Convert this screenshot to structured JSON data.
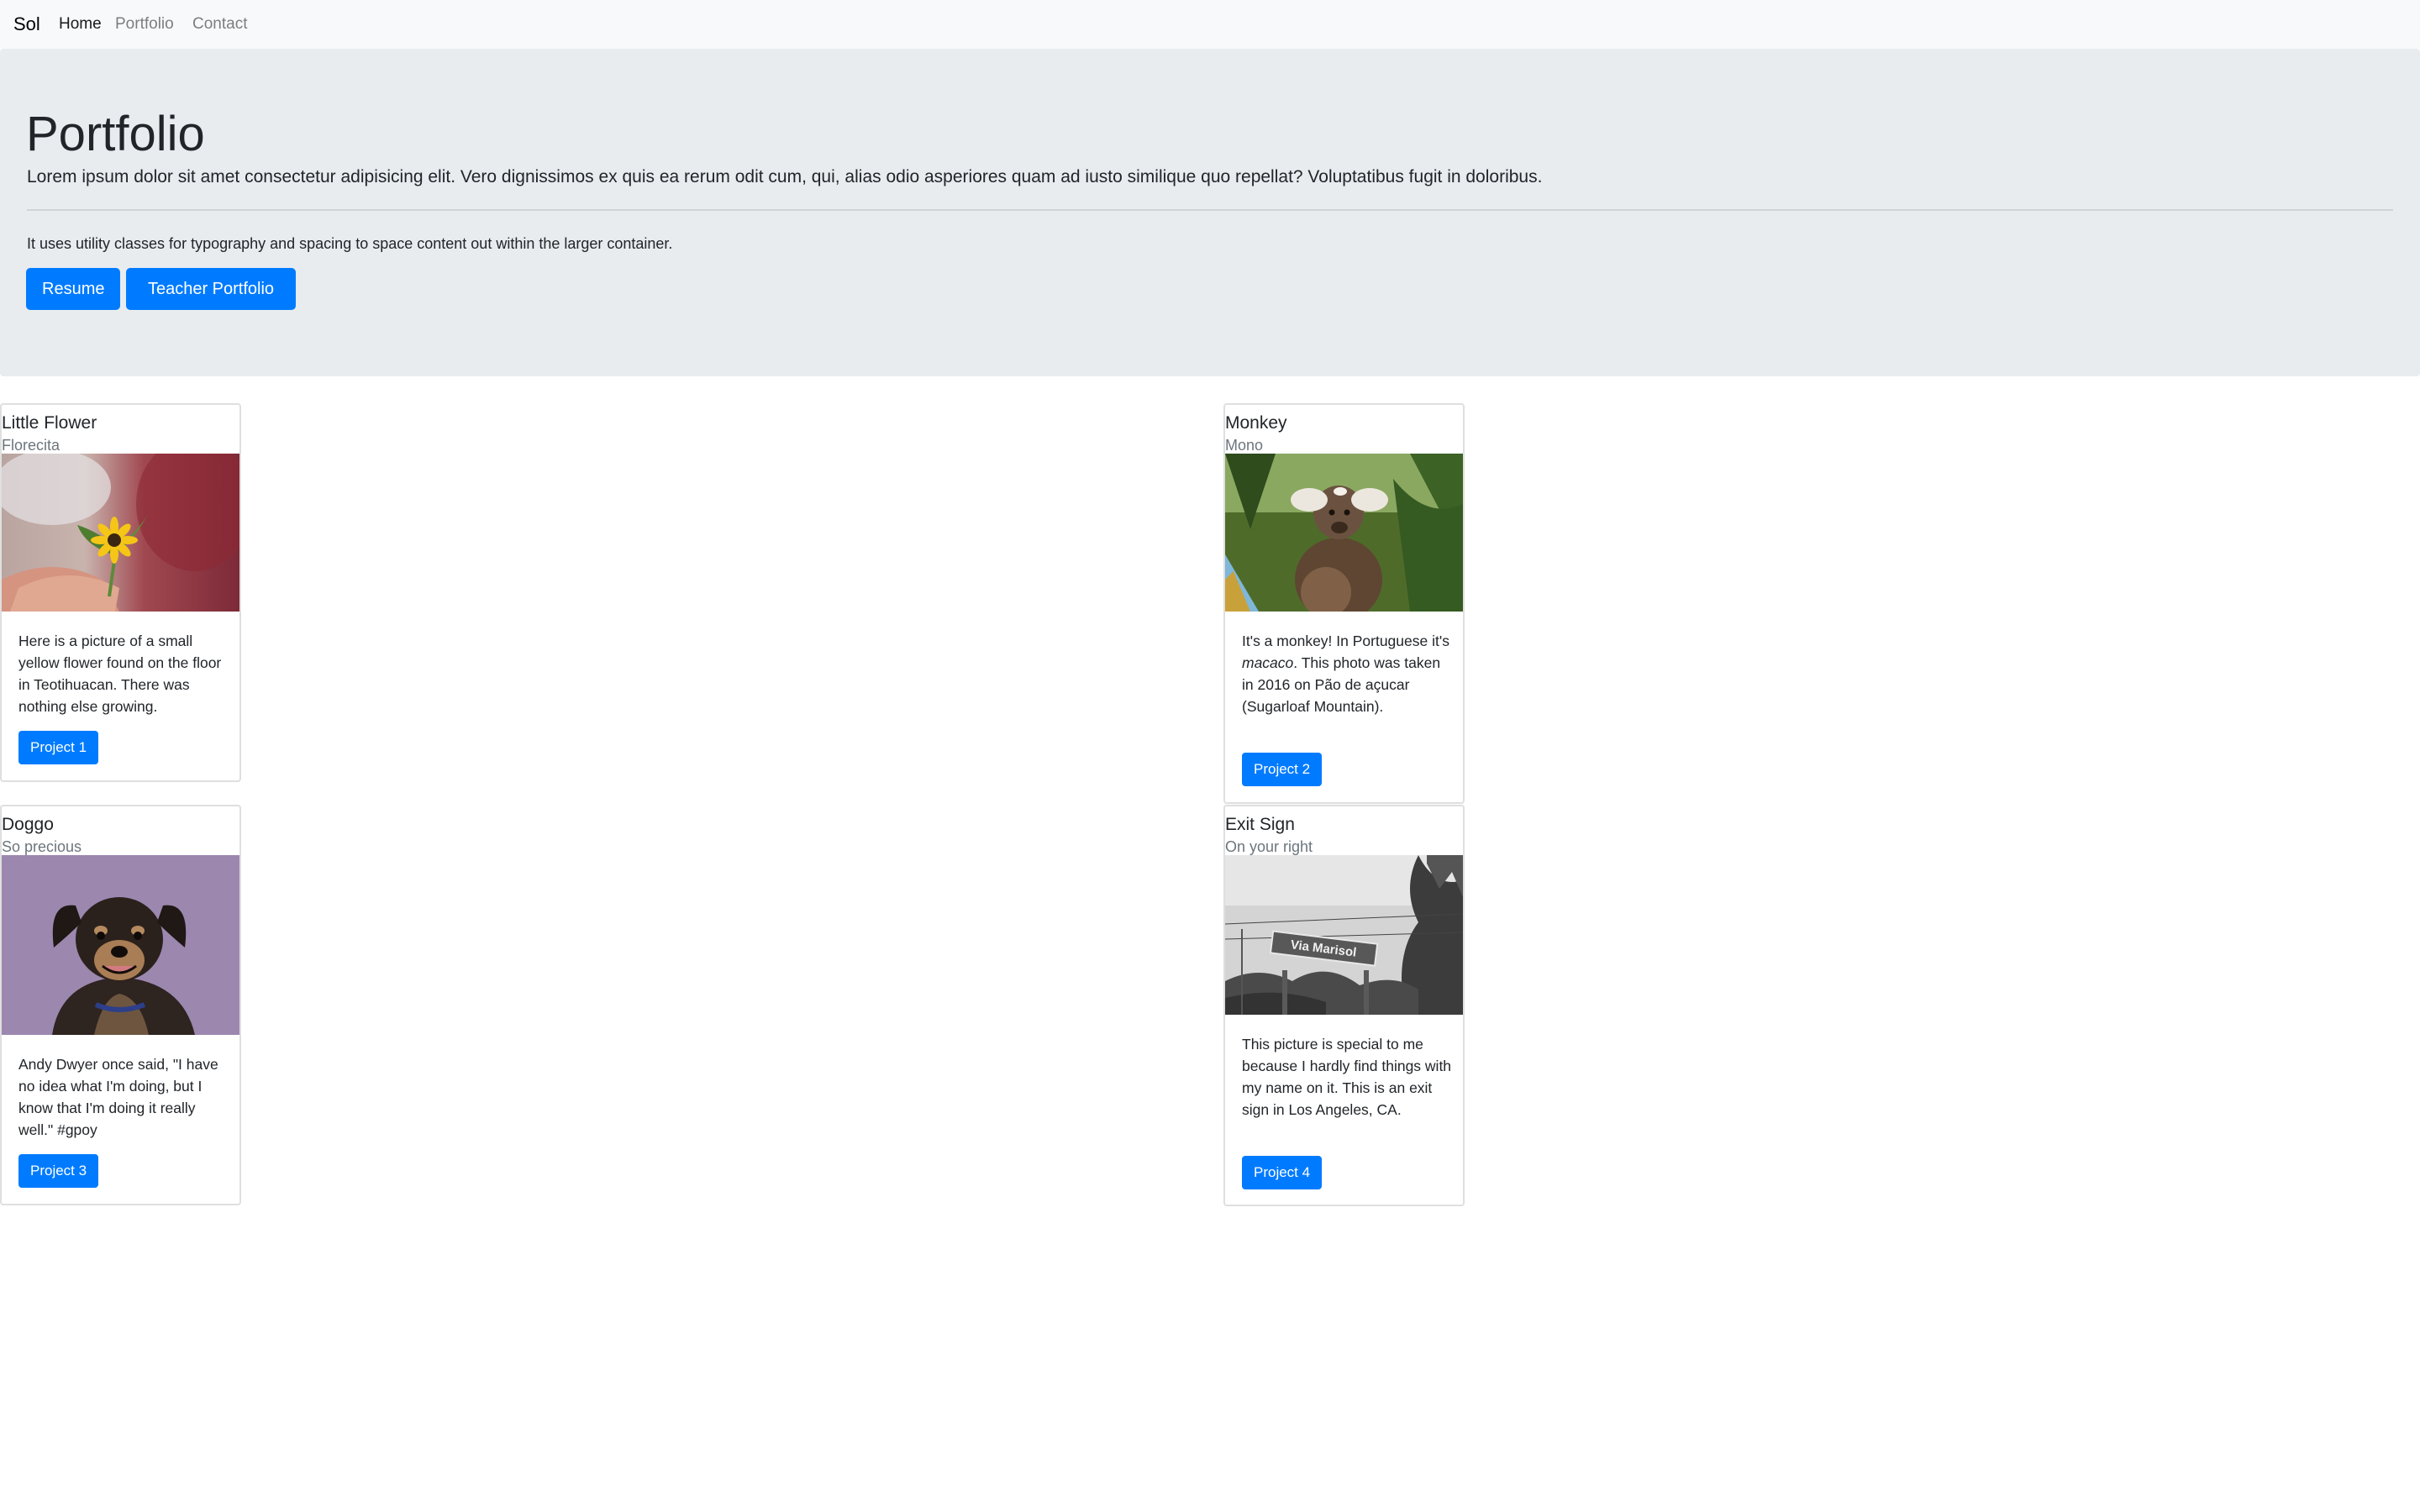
{
  "navbar": {
    "brand": "Sol",
    "links": [
      "Home",
      "Portfolio",
      "Contact"
    ]
  },
  "jumbotron": {
    "title": "Portfolio",
    "lead": "Lorem ipsum dolor sit amet consectetur adipisicing elit. Vero dignissimos ex quis ea rerum odit cum, qui, alias odio asperiores quam ad iusto similique quo repellat? Voluptatibus fugit in doloribus.",
    "small_text": "It uses utility classes for typography and spacing to space content out within the larger container.",
    "buttons": [
      "Resume",
      "Teacher Portfolio"
    ]
  },
  "cards": [
    {
      "title": "Little Flower",
      "subtitle": "Florecita",
      "image": "yellow-flower-photo",
      "text": "Here is a picture of a small yellow flower found on the floor in Teotihuacan. There was nothing else growing.",
      "button": "Project 1"
    },
    {
      "title": "Monkey",
      "subtitle": "Mono",
      "image": "monkey-photo",
      "text_before": "It's a monkey! In Portuguese it's ",
      "text_em": "macaco",
      "text_after": ". This photo was taken in 2016 on Pão de açucar (Sugarloaf Mountain).",
      "button": "Project 2"
    },
    {
      "title": "Doggo",
      "subtitle": "So precious",
      "image": "dog-photo",
      "text": "Andy Dwyer once said, \"I have no idea what I'm doing, but I know that I'm doing it really well.\" #gpoy",
      "button": "Project 3"
    },
    {
      "title": "Exit Sign",
      "subtitle": "On your right",
      "image": "exit-sign-photo",
      "sign_text": "Via Marisol",
      "text": "This picture is special to me because I hardly find things with my name on it. This is an exit sign in Los Angeles, CA.",
      "button": "Project 4"
    }
  ],
  "colors": {
    "primary": "#007bff",
    "navbar_bg": "#f8f9fa",
    "jumbotron_bg": "#e9ecef",
    "muted": "#6c757d"
  }
}
